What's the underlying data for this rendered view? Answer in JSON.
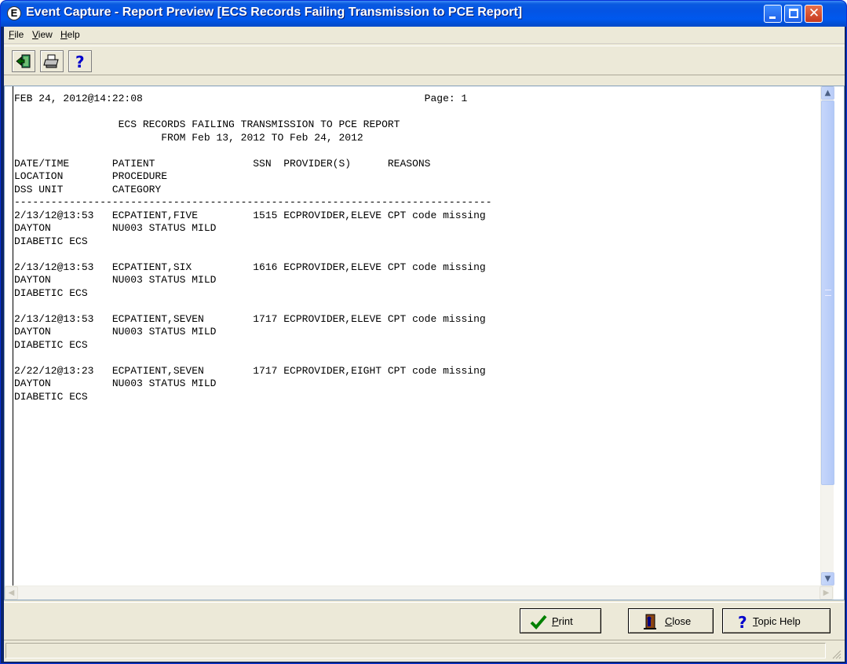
{
  "window": {
    "title": "Event Capture - Report Preview [ECS Records Failing Transmission to PCE Report]",
    "app_icon_letter": "E"
  },
  "menu": {
    "items": [
      {
        "label": "File",
        "mnemonic": "F",
        "rest": "ile"
      },
      {
        "label": "View",
        "mnemonic": "V",
        "rest": "iew"
      },
      {
        "label": "Help",
        "mnemonic": "H",
        "rest": "elp"
      }
    ]
  },
  "toolbar": {
    "buttons": [
      "exit-icon",
      "printer-icon",
      "help-question-icon"
    ]
  },
  "report": {
    "lines": [
      "FEB 24, 2012@14:22:08                                              Page: 1",
      "",
      "                 ECS RECORDS FAILING TRANSMISSION TO PCE REPORT",
      "                        FROM Feb 13, 2012 TO Feb 24, 2012",
      "",
      "DATE/TIME       PATIENT                SSN  PROVIDER(S)      REASONS",
      "LOCATION        PROCEDURE",
      "DSS UNIT        CATEGORY",
      "------------------------------------------------------------------------------",
      "2/13/12@13:53   ECPATIENT,FIVE         1515 ECPROVIDER,ELEVE CPT code missing",
      "DAYTON          NU003 STATUS MILD",
      "DIABETIC ECS",
      "",
      "2/13/12@13:53   ECPATIENT,SIX          1616 ECPROVIDER,ELEVE CPT code missing",
      "DAYTON          NU003 STATUS MILD",
      "DIABETIC ECS",
      "",
      "2/13/12@13:53   ECPATIENT,SEVEN        1717 ECPROVIDER,ELEVE CPT code missing",
      "DAYTON          NU003 STATUS MILD",
      "DIABETIC ECS",
      "",
      "2/22/12@13:23   ECPATIENT,SEVEN        1717 ECPROVIDER,EIGHT CPT code missing",
      "DAYTON          NU003 STATUS MILD",
      "DIABETIC ECS"
    ]
  },
  "buttons": {
    "print": {
      "mnemonic": "P",
      "rest": "rint"
    },
    "close": {
      "mnemonic": "C",
      "rest": "lose"
    },
    "topic_help": {
      "mnemonic": "T",
      "rest": "opic Help"
    }
  },
  "colors": {
    "titlebar": "#0058ee",
    "client_bg": "#ece9d8",
    "report_bg": "#ffffff"
  }
}
